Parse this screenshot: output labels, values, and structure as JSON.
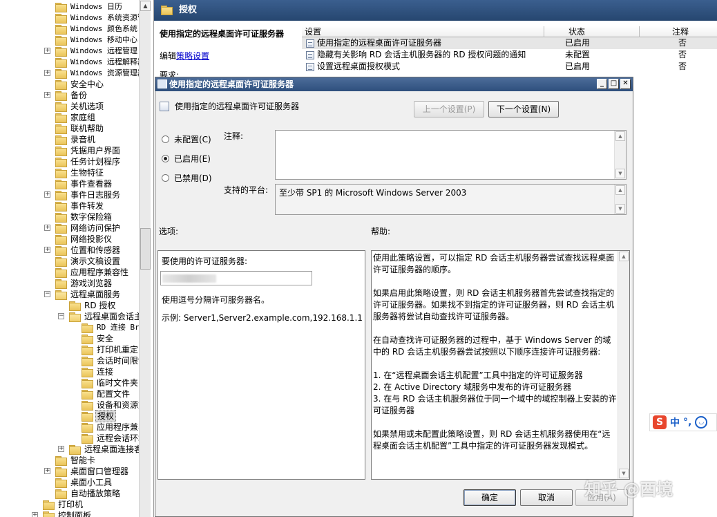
{
  "tree": {
    "items": [
      {
        "label": "Windows 日历",
        "mono": true
      },
      {
        "label": "Windows 系统资源管",
        "mono": true
      },
      {
        "label": "Windows 颜色系统",
        "mono": true
      },
      {
        "label": "Windows 移动中心",
        "mono": true
      },
      {
        "label": "Windows 远程管理",
        "mono": true,
        "expand": "+"
      },
      {
        "label": "Windows 远程解释器",
        "mono": true
      },
      {
        "label": "Windows 资源管理器",
        "mono": true,
        "expand": "+"
      },
      {
        "label": "安全中心"
      },
      {
        "label": "备份",
        "expand": "+"
      },
      {
        "label": "关机选项"
      },
      {
        "label": "家庭组"
      },
      {
        "label": "联机帮助"
      },
      {
        "label": "录音机"
      },
      {
        "label": "凭据用户界面"
      },
      {
        "label": "任务计划程序"
      },
      {
        "label": "生物特征"
      },
      {
        "label": "事件查看器"
      },
      {
        "label": "事件日志服务",
        "expand": "+"
      },
      {
        "label": "事件转发"
      },
      {
        "label": "数字保险箱"
      },
      {
        "label": "网络访问保护",
        "expand": "+"
      },
      {
        "label": "网络投影仪"
      },
      {
        "label": "位置和传感器",
        "expand": "+"
      },
      {
        "label": "演示文稿设置"
      },
      {
        "label": "应用程序兼容性"
      },
      {
        "label": "游戏浏览器"
      },
      {
        "label": "远程桌面服务",
        "expand": "-",
        "open": true
      },
      {
        "label": "RD 授权",
        "level": 2
      },
      {
        "label": "远程桌面会话主机",
        "level": 2,
        "expand": "-",
        "open": true
      },
      {
        "label": "RD 连接 Broker",
        "level": 3,
        "mono": true
      },
      {
        "label": "安全",
        "level": 3
      },
      {
        "label": "打印机重定向",
        "level": 3
      },
      {
        "label": "会话时间限制",
        "level": 3
      },
      {
        "label": "连接",
        "level": 3
      },
      {
        "label": "临时文件夹",
        "level": 3
      },
      {
        "label": "配置文件",
        "level": 3
      },
      {
        "label": "设备和资源重定向",
        "level": 3
      },
      {
        "label": "授权",
        "level": 3,
        "selected": true
      },
      {
        "label": "应用程序兼容性",
        "level": 3
      },
      {
        "label": "远程会话环境",
        "level": 3
      },
      {
        "label": "远程桌面连接客户端",
        "level": 2,
        "expand": "+"
      },
      {
        "label": "智能卡"
      },
      {
        "label": "桌面窗口管理器",
        "expand": "+"
      },
      {
        "label": "桌面小工具"
      },
      {
        "label": "自动播放策略"
      },
      {
        "label": "打印机",
        "level": 0
      },
      {
        "label": "控制面板",
        "level": 0,
        "expand": "+"
      }
    ]
  },
  "right_panel": {
    "header_title": "授权",
    "policy_name": "使用指定的远程桌面许可证服务器",
    "edit_prefix": "编辑",
    "edit_link": "策略设置",
    "requirements_label": "要求:",
    "columns": {
      "setting": "设置",
      "state": "状态",
      "comment": "注释"
    },
    "rows": [
      {
        "setting": "使用指定的远程桌面许可证服务器",
        "state": "已启用",
        "comment": "否"
      },
      {
        "setting": "隐藏有关影响 RD 会话主机服务器的 RD 授权问题的通知",
        "state": "未配置",
        "comment": "否"
      },
      {
        "setting": "设置远程桌面授权模式",
        "state": "已启用",
        "comment": "否"
      }
    ]
  },
  "dialog": {
    "title": "使用指定的远程桌面许可证服务器",
    "subtitle": "使用指定的远程桌面许可证服务器",
    "prev_button": "上一个设置(P)",
    "next_button": "下一个设置(N)",
    "radio_not_configured": "未配置(C)",
    "radio_enabled": "已启用(E)",
    "radio_disabled": "已禁用(D)",
    "comment_label": "注释:",
    "platform_label": "支持的平台:",
    "platform_value": "至少带 SP1 的 Microsoft Windows Server 2003",
    "options_label": "选项:",
    "help_label": "帮助:",
    "options": {
      "server_label": "要使用的许可证服务器:",
      "separator_hint": "使用逗号分隔许可服务器名。",
      "example": "示例: Server1,Server2.example.com,192.168.1.1"
    },
    "help_paragraphs": [
      "使用此策略设置，可以指定 RD 会话主机服务器尝试查找远程桌面许可证服务器的顺序。",
      "如果启用此策略设置，则 RD 会话主机服务器首先尝试查找指定的许可证服务器。如果找不到指定的许可证服务器，则 RD 会话主机服务器将尝试自动查找许可证服务器。",
      "在自动查找许可证服务器的过程中，基于 Windows Server 的域中的 RD 会话主机服务器尝试按照以下顺序连接许可证服务器:",
      "1. 在“远程桌面会话主机配置”工具中指定的许可证服务器\n2. 在 Active Directory 域服务中发布的许可证服务器\n3. 在与 RD 会话主机服务器位于同一个域中的域控制器上安装的许可证服务器",
      "如果禁用或未配置此策略设置，则 RD 会话主机服务器使用在“远程桌面会话主机配置”工具中指定的许可证服务器发现模式。"
    ],
    "ok_button": "确定",
    "cancel_button": "取消",
    "apply_button": "应用(A)"
  },
  "ime": {
    "logo": "S",
    "mode": "中",
    "punct": "°,"
  },
  "watermark": "知乎 @酉境"
}
